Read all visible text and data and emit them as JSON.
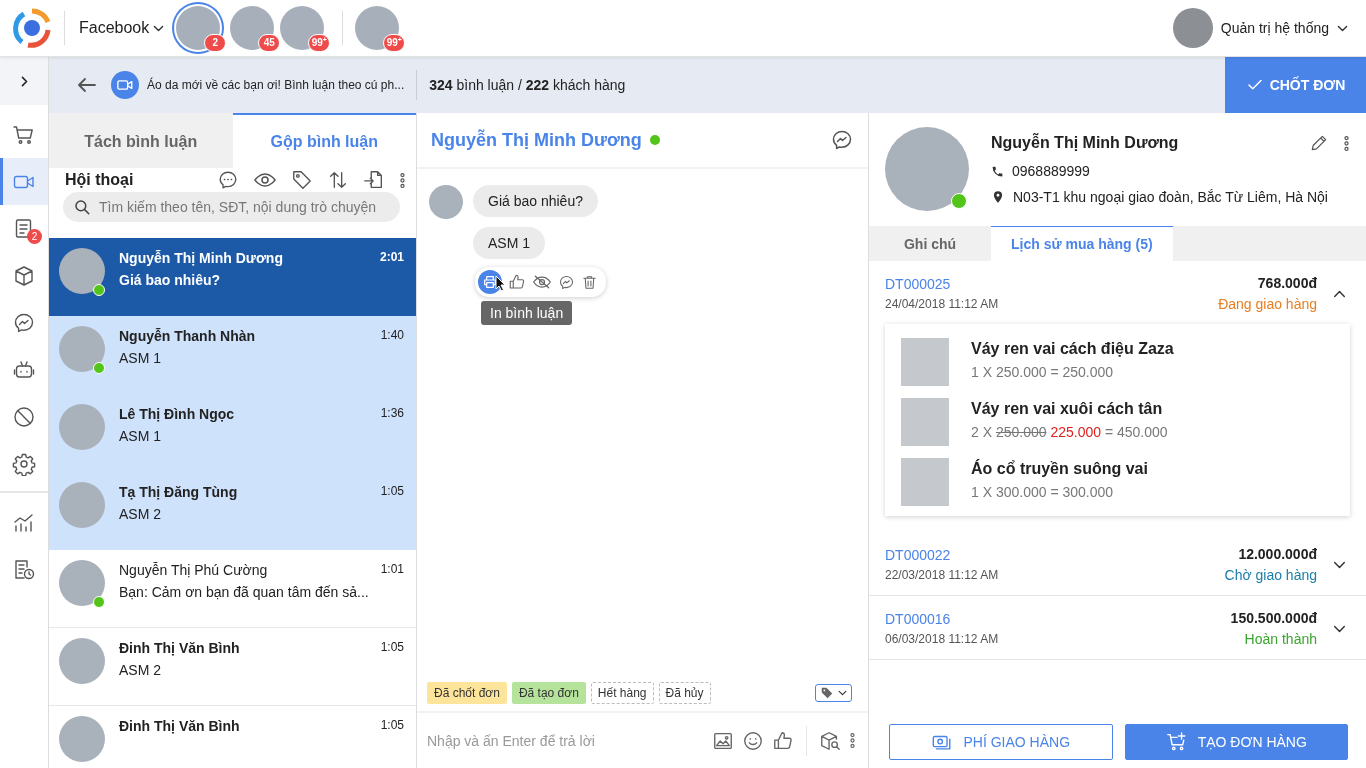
{
  "topbar": {
    "platform": "Facebook",
    "pages": [
      {
        "badge": "2",
        "selected": true
      },
      {
        "badge": "45",
        "selected": false
      },
      {
        "badge": "99$^{+}$",
        "selected": false
      }
    ],
    "other_pages": [
      {
        "badge": "99$^{+}$",
        "selected": false
      }
    ],
    "user": "Quản trị hệ thống"
  },
  "rail": {
    "items": [
      {
        "kind": "cart",
        "selected": false
      },
      {
        "kind": "video",
        "selected": true
      },
      {
        "kind": "orders",
        "selected": false,
        "badge": "2"
      },
      {
        "kind": "box",
        "selected": false
      },
      {
        "kind": "messenger",
        "selected": false
      },
      {
        "kind": "bot",
        "selected": false
      },
      {
        "kind": "block",
        "selected": false
      },
      {
        "kind": "settings",
        "selected": false
      }
    ],
    "tools": [
      {
        "kind": "chart",
        "selected": false
      },
      {
        "kind": "report",
        "selected": false
      }
    ]
  },
  "post_bar": {
    "title": "Áo da mới về các bạn ơi! Bình luận theo cú ph...",
    "stats": "**324** bình luận / **222** khách hàng",
    "action": "CHỐT ĐƠN"
  },
  "list_tabs": [
    {
      "label": "Tách bình luận",
      "selected": false
    },
    {
      "label": "Gộp bình luận",
      "selected": true
    }
  ],
  "conversations": {
    "title": "Hội thoại",
    "search_placeholder": "Tìm kiếm theo tên, SĐT, nội dung trò chuyện",
    "items": [
      {
        "name": "Nguyễn Thị Minh Dương",
        "message": "Giá bao nhiêu?",
        "time": "2:01",
        "selected": true,
        "highlighted": false,
        "unread": true,
        "online": true
      },
      {
        "name": "Nguyễn Thanh Nhàn",
        "message": "ASM 1",
        "time": "1:40",
        "selected": false,
        "highlighted": true,
        "unread": true,
        "online": true
      },
      {
        "name": "Lê Thị Đình Ngọc",
        "message": "ASM 1",
        "time": "1:36",
        "selected": false,
        "highlighted": true,
        "unread": true,
        "online": false
      },
      {
        "name": "Tạ Thị Đăng Tùng",
        "message": "ASM 2",
        "time": "1:05",
        "selected": false,
        "highlighted": true,
        "unread": true,
        "online": false
      },
      {
        "name": "Nguyễn Thị Phú Cường",
        "message": "Bạn: Cảm ơn bạn đã quan tâm đến sả...",
        "time": "1:01",
        "selected": false,
        "highlighted": false,
        "unread": false,
        "online": true
      },
      {
        "name": "Đinh Thị Văn Bình",
        "message": "ASM 2",
        "time": "1:05",
        "selected": false,
        "highlighted": false,
        "unread": true,
        "online": false
      },
      {
        "name": "Đinh Thị Văn Bình",
        "time": "1:05",
        "selected": false,
        "highlighted": false,
        "unread": true,
        "online": false
      }
    ]
  },
  "chat": {
    "contact": "Nguyễn Thị Minh Dương",
    "online": true,
    "messages": [
      {
        "text": "Giá bao nhiêu?"
      },
      {
        "text": "ASM 1"
      }
    ],
    "tooltip": "In bình luận",
    "tags": [
      {
        "label": "Đã chốt đơn",
        "selected": true,
        "color": "#fde49b"
      },
      {
        "label": "Đã tạo đơn",
        "selected": true,
        "color": "#b5e39b"
      },
      {
        "label": "Hết hàng",
        "selected": false
      },
      {
        "label": "Đã hủy",
        "selected": false
      }
    ],
    "input_placeholder": "Nhập và ấn Enter để trả lời"
  },
  "customer": {
    "name": "Nguyễn Thị Minh Dương",
    "online": true,
    "phone": "0968889999",
    "address": "N03-T1 khu ngoại giao đoàn, Bắc Từ Liêm, Hà Nội",
    "tabs": [
      {
        "label": "Ghi chú",
        "selected": false
      },
      {
        "label": "Lịch sử mua hàng (5)",
        "selected": true
      }
    ],
    "orders": [
      {
        "code": "DT000025",
        "date": "24/04/2018 11:12 AM",
        "total": "768.000đ",
        "status": "Đang giao hàng",
        "color": "#e67e22",
        "expanded": true,
        "items": [
          {
            "name": "Váy ren vai cách điệu Zaza",
            "qty": "1 X",
            "price": "250.000",
            "result": "= 250.000"
          },
          {
            "name": "Váy ren vai xuôi cách tân",
            "qty": "2 X",
            "old_price": "250.000",
            "price": "225.000",
            "result": "= 450.000"
          },
          {
            "name": "Áo cổ truyền suông vai",
            "qty": "1 X",
            "price": "300.000",
            "result": "= 300.000"
          }
        ]
      },
      {
        "code": "DT000022",
        "date": "22/03/2018 11:12 AM",
        "total": "12.000.000đ",
        "status": "Chờ giao hàng",
        "color": "#1b7ea6",
        "expanded": false
      },
      {
        "code": "DT000016",
        "date": "06/03/2018 11:12 AM",
        "total": "150.500.000đ",
        "status": "Hoàn thành",
        "color": "#3aa52f",
        "expanded": false
      }
    ],
    "buttons": [
      {
        "label": "PHÍ GIAO HÀNG",
        "kind": "outline"
      },
      {
        "label": "TẠO ĐƠN HÀNG",
        "kind": "primary"
      }
    ]
  }
}
